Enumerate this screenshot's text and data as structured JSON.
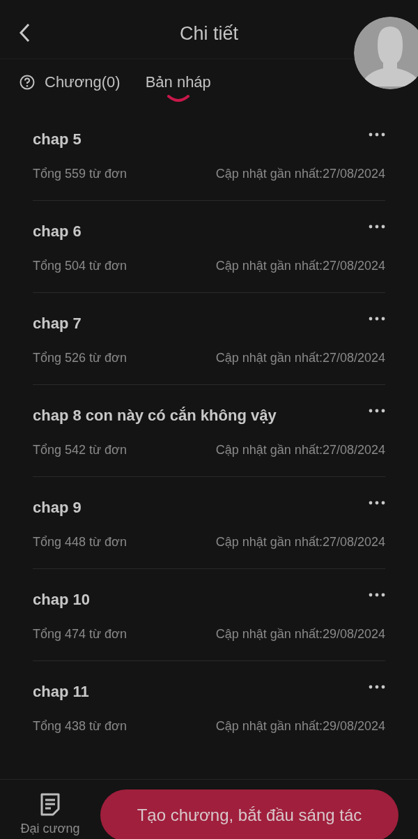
{
  "header": {
    "title": "Chi tiết"
  },
  "tabs": [
    {
      "label": "Chương(0)",
      "selected": false,
      "kind": "help"
    },
    {
      "label": "Bản nháp",
      "selected": true,
      "kind": "plain"
    }
  ],
  "drafts": [
    {
      "title": "chap 5",
      "words": "Tổng 559 từ đơn",
      "updated": "Cập nhật gần nhất:27/08/2024"
    },
    {
      "title": "chap 6",
      "words": "Tổng 504 từ đơn",
      "updated": "Cập nhật gần nhất:27/08/2024"
    },
    {
      "title": "chap 7",
      "words": "Tổng 526 từ đơn",
      "updated": "Cập nhật gần nhất:27/08/2024"
    },
    {
      "title": "chap 8 con này có cắn không vậy",
      "words": "Tổng 542 từ đơn",
      "updated": "Cập nhật gần nhất:27/08/2024"
    },
    {
      "title": "chap 9",
      "words": "Tổng 448 từ đơn",
      "updated": "Cập nhật gần nhất:27/08/2024"
    },
    {
      "title": "chap 10",
      "words": "Tổng 474 từ đơn",
      "updated": "Cập nhật gần nhất:29/08/2024"
    },
    {
      "title": "chap 11",
      "words": "Tổng 438 từ đơn",
      "updated": "Cập nhật gần nhất:29/08/2024"
    }
  ],
  "bottom_bar": {
    "outline_label": "Đại cương",
    "create_button": "Tạo chương, bắt đầu sáng tác"
  }
}
